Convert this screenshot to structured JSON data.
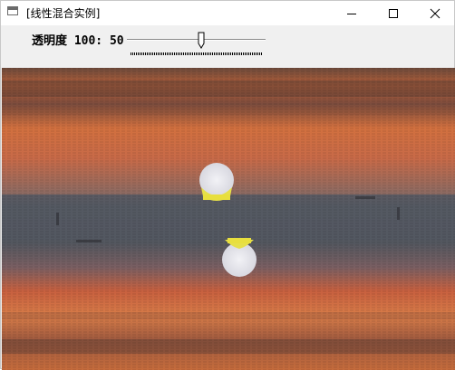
{
  "window": {
    "title": "[线性混合实例]",
    "controls": [
      "minimize",
      "maximize",
      "close"
    ]
  },
  "trackbar": {
    "label": "透明度 100: 50",
    "value": 50,
    "max": 100
  },
  "image": {
    "description_icon": "sunset-blend-image",
    "colors": {
      "sky_top": "#6a4a3a",
      "sky_orange": "#d6743e",
      "sea_gray": "#565a64",
      "sun_yellow": "#e8e048",
      "sun_white": "#e8e8ee"
    }
  }
}
